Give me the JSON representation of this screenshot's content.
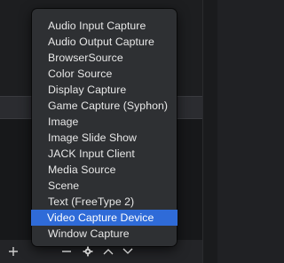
{
  "menu": {
    "items": [
      {
        "label": "Audio Input Capture"
      },
      {
        "label": "Audio Output Capture"
      },
      {
        "label": "BrowserSource"
      },
      {
        "label": "Color Source"
      },
      {
        "label": "Display Capture"
      },
      {
        "label": "Game Capture (Syphon)"
      },
      {
        "label": "Image"
      },
      {
        "label": "Image Slide Show"
      },
      {
        "label": "JACK Input Client"
      },
      {
        "label": "Media Source"
      },
      {
        "label": "Scene"
      },
      {
        "label": "Text (FreeType 2)"
      },
      {
        "label": "Video Capture Device"
      },
      {
        "label": "Window Capture"
      }
    ],
    "selected_index": 12
  },
  "toolbar": {
    "icons": [
      "add-icon",
      "remove-icon",
      "gear-icon",
      "chevron-up-icon",
      "chevron-down-icon"
    ]
  },
  "colors": {
    "selection": "#2f6bd8",
    "menu_background": "#2e3033",
    "menu_text": "#e8e8e8"
  }
}
